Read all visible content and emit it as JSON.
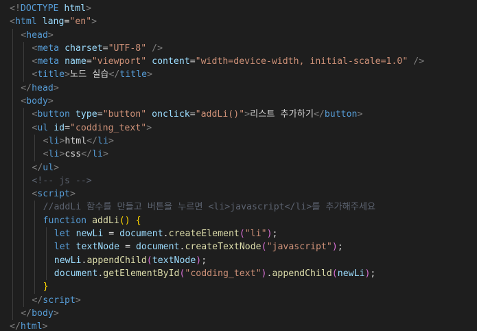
{
  "editor": {
    "lines": [
      {
        "indent": 0,
        "tokens": [
          [
            "br",
            "<!"
          ],
          [
            "t",
            "DOCTYPE"
          ],
          [
            "tx",
            " "
          ],
          [
            "a",
            "html"
          ],
          [
            "br",
            ">"
          ]
        ]
      },
      {
        "indent": 0,
        "tokens": [
          [
            "br",
            "<"
          ],
          [
            "t",
            "html"
          ],
          [
            "tx",
            " "
          ],
          [
            "a",
            "lang"
          ],
          [
            "o",
            "="
          ],
          [
            "s",
            "\"en\""
          ],
          [
            "br",
            ">"
          ]
        ]
      },
      {
        "indent": 1,
        "tokens": [
          [
            "br",
            "<"
          ],
          [
            "t",
            "head"
          ],
          [
            "br",
            ">"
          ]
        ]
      },
      {
        "indent": 2,
        "tokens": [
          [
            "br",
            "<"
          ],
          [
            "t",
            "meta"
          ],
          [
            "tx",
            " "
          ],
          [
            "a",
            "charset"
          ],
          [
            "o",
            "="
          ],
          [
            "s",
            "\"UTF-8\""
          ],
          [
            "tx",
            " "
          ],
          [
            "br",
            "/>"
          ]
        ]
      },
      {
        "indent": 2,
        "tokens": [
          [
            "br",
            "<"
          ],
          [
            "t",
            "meta"
          ],
          [
            "tx",
            " "
          ],
          [
            "a",
            "name"
          ],
          [
            "o",
            "="
          ],
          [
            "s",
            "\"viewport\""
          ],
          [
            "tx",
            " "
          ],
          [
            "a",
            "content"
          ],
          [
            "o",
            "="
          ],
          [
            "s",
            "\"width=device-width, initial-scale=1.0\""
          ],
          [
            "tx",
            " "
          ],
          [
            "br",
            "/>"
          ]
        ]
      },
      {
        "indent": 2,
        "tokens": [
          [
            "br",
            "<"
          ],
          [
            "t",
            "title"
          ],
          [
            "br",
            ">"
          ],
          [
            "tx",
            "노드 실습"
          ],
          [
            "br",
            "</"
          ],
          [
            "t",
            "title"
          ],
          [
            "br",
            ">"
          ]
        ]
      },
      {
        "indent": 1,
        "tokens": [
          [
            "br",
            "</"
          ],
          [
            "t",
            "head"
          ],
          [
            "br",
            ">"
          ]
        ]
      },
      {
        "indent": 1,
        "tokens": [
          [
            "br",
            "<"
          ],
          [
            "t",
            "body"
          ],
          [
            "br",
            ">"
          ]
        ]
      },
      {
        "indent": 2,
        "tokens": [
          [
            "br",
            "<"
          ],
          [
            "t",
            "button"
          ],
          [
            "tx",
            " "
          ],
          [
            "a",
            "type"
          ],
          [
            "o",
            "="
          ],
          [
            "s",
            "\"button\""
          ],
          [
            "tx",
            " "
          ],
          [
            "a",
            "onclick"
          ],
          [
            "o",
            "="
          ],
          [
            "s",
            "\"addLi()\""
          ],
          [
            "br",
            ">"
          ],
          [
            "tx",
            "리스트 추가하기"
          ],
          [
            "br",
            "</"
          ],
          [
            "t",
            "button"
          ],
          [
            "br",
            ">"
          ]
        ]
      },
      {
        "indent": 2,
        "tokens": [
          [
            "br",
            "<"
          ],
          [
            "t",
            "ul"
          ],
          [
            "tx",
            " "
          ],
          [
            "a",
            "id"
          ],
          [
            "o",
            "="
          ],
          [
            "s",
            "\"codding_text\""
          ],
          [
            "br",
            ">"
          ]
        ]
      },
      {
        "indent": 3,
        "tokens": [
          [
            "br",
            "<"
          ],
          [
            "t",
            "li"
          ],
          [
            "br",
            ">"
          ],
          [
            "tx",
            "html"
          ],
          [
            "br",
            "</"
          ],
          [
            "t",
            "li"
          ],
          [
            "br",
            ">"
          ]
        ]
      },
      {
        "indent": 3,
        "tokens": [
          [
            "br",
            "<"
          ],
          [
            "t",
            "li"
          ],
          [
            "br",
            ">"
          ],
          [
            "tx",
            "css"
          ],
          [
            "br",
            "</"
          ],
          [
            "t",
            "li"
          ],
          [
            "br",
            ">"
          ]
        ]
      },
      {
        "indent": 2,
        "tokens": [
          [
            "br",
            "</"
          ],
          [
            "t",
            "ul"
          ],
          [
            "br",
            ">"
          ]
        ]
      },
      {
        "indent": 2,
        "tokens": [
          [
            "cm",
            "<!-- js -->"
          ]
        ]
      },
      {
        "indent": 2,
        "tokens": [
          [
            "br",
            "<"
          ],
          [
            "t",
            "script"
          ],
          [
            "br",
            ">"
          ]
        ]
      },
      {
        "indent": 3,
        "tokens": [
          [
            "cm",
            "//addLi 함수를 만들고 버튼을 누르면 <li>javascript</li>를 추가해주세요"
          ]
        ]
      },
      {
        "indent": 3,
        "tokens": [
          [
            "kw",
            "function"
          ],
          [
            "tx",
            " "
          ],
          [
            "fn",
            "addLi"
          ],
          [
            "p1",
            "()"
          ],
          [
            "tx",
            " "
          ],
          [
            "p1",
            "{"
          ]
        ]
      },
      {
        "indent": 4,
        "tokens": [
          [
            "kw",
            "let"
          ],
          [
            "tx",
            " "
          ],
          [
            "v",
            "newLi"
          ],
          [
            "tx",
            " "
          ],
          [
            "o",
            "="
          ],
          [
            "tx",
            " "
          ],
          [
            "v",
            "document"
          ],
          [
            "o",
            "."
          ],
          [
            "fn",
            "createElement"
          ],
          [
            "p2",
            "("
          ],
          [
            "s",
            "\"li\""
          ],
          [
            "p2",
            ")"
          ],
          [
            "o",
            ";"
          ]
        ]
      },
      {
        "indent": 4,
        "tokens": [
          [
            "kw",
            "let"
          ],
          [
            "tx",
            " "
          ],
          [
            "v",
            "textNode"
          ],
          [
            "tx",
            " "
          ],
          [
            "o",
            "="
          ],
          [
            "tx",
            " "
          ],
          [
            "v",
            "document"
          ],
          [
            "o",
            "."
          ],
          [
            "fn",
            "createTextNode"
          ],
          [
            "p2",
            "("
          ],
          [
            "s",
            "\"javascript\""
          ],
          [
            "p2",
            ")"
          ],
          [
            "o",
            ";"
          ]
        ]
      },
      {
        "indent": 4,
        "tokens": [
          [
            "v",
            "newLi"
          ],
          [
            "o",
            "."
          ],
          [
            "fn",
            "appendChild"
          ],
          [
            "p2",
            "("
          ],
          [
            "v",
            "textNode"
          ],
          [
            "p2",
            ")"
          ],
          [
            "o",
            ";"
          ]
        ]
      },
      {
        "indent": 4,
        "tokens": [
          [
            "v",
            "document"
          ],
          [
            "o",
            "."
          ],
          [
            "fn",
            "getElementById"
          ],
          [
            "p2",
            "("
          ],
          [
            "s",
            "\"codding_text\""
          ],
          [
            "p2",
            ")"
          ],
          [
            "o",
            "."
          ],
          [
            "fn",
            "appendChild"
          ],
          [
            "p2",
            "("
          ],
          [
            "v",
            "newLi"
          ],
          [
            "p2",
            ")"
          ],
          [
            "o",
            ";"
          ]
        ]
      },
      {
        "indent": 3,
        "tokens": [
          [
            "p1",
            "}"
          ]
        ]
      },
      {
        "indent": 2,
        "tokens": [
          [
            "br",
            "</"
          ],
          [
            "t",
            "script"
          ],
          [
            "br",
            ">"
          ]
        ]
      },
      {
        "indent": 1,
        "tokens": [
          [
            "br",
            "</"
          ],
          [
            "t",
            "body"
          ],
          [
            "br",
            ">"
          ]
        ]
      },
      {
        "indent": 0,
        "tokens": [
          [
            "br",
            "</"
          ],
          [
            "t",
            "html"
          ],
          [
            "br",
            ">"
          ]
        ]
      }
    ]
  },
  "colors": {
    "background": "#1e1e1e",
    "tag": "#569cd6",
    "attribute": "#9cdcfe",
    "string": "#ce9178",
    "comment": "#5c6370",
    "function": "#dcdcaa",
    "keyword": "#569cd6",
    "indent_guide": "#3c3c3c"
  }
}
